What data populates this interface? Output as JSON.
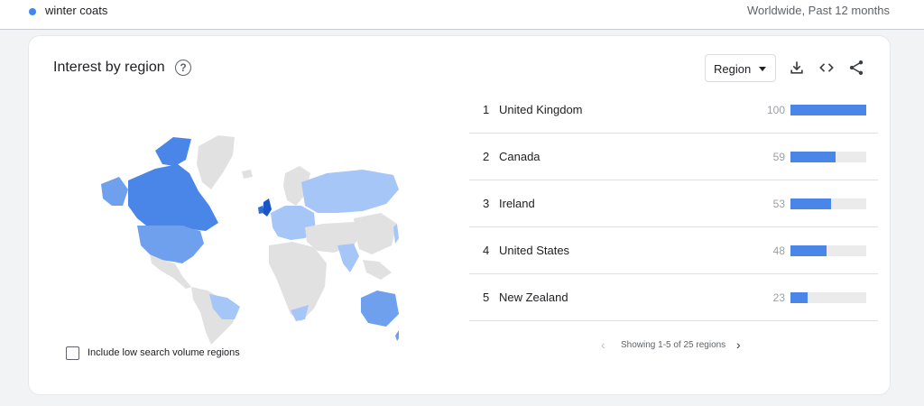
{
  "search": {
    "term": "winter coats",
    "meta": "Worldwide, Past 12 months",
    "term_color": "#4285f4"
  },
  "panel": {
    "title": "Interest by region",
    "help_icon": "help-circle-icon",
    "resolution_select": "Region",
    "tools": [
      "download-icon",
      "embed-code-icon",
      "share-icon"
    ],
    "low_volume_checkbox": {
      "label": "Include low search volume regions",
      "checked": false
    }
  },
  "colors": {
    "bar": "#4a86e8",
    "bar_track": "#ebebeb",
    "map_strong": "#4a86e8",
    "map_medium": "#6ea0ee",
    "map_light": "#a6c6f7",
    "map_none": "#e1e1e1"
  },
  "regions": [
    {
      "rank": "1",
      "name": "United Kingdom",
      "value": 100
    },
    {
      "rank": "2",
      "name": "Canada",
      "value": 59
    },
    {
      "rank": "3",
      "name": "Ireland",
      "value": 53
    },
    {
      "rank": "4",
      "name": "United States",
      "value": 48
    },
    {
      "rank": "5",
      "name": "New Zealand",
      "value": 23
    }
  ],
  "pagination": {
    "text": "Showing 1-5 of 25 regions",
    "prev_icon": "chevron-left-icon",
    "next_icon": "chevron-right-icon"
  }
}
